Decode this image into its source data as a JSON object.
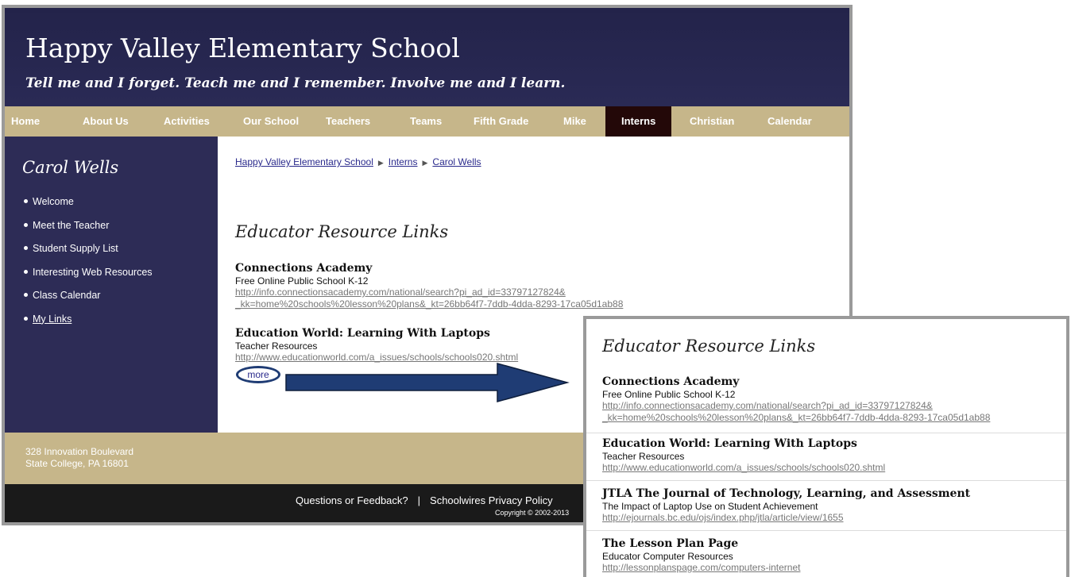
{
  "site": {
    "title": "Happy Valley Elementary School",
    "tagline": "Tell me and I forget. Teach me and I remember. Involve me and I learn."
  },
  "nav": [
    "Home",
    "About Us",
    "Activities",
    "Our School",
    "Teachers",
    "Teams",
    "Fifth Grade",
    "Mike",
    "Interns",
    "Christian",
    "Calendar"
  ],
  "nav_active": "Interns",
  "sidebar": {
    "title": "Carol Wells",
    "items": [
      "Welcome",
      "Meet the Teacher",
      "Student Supply List",
      "Interesting Web Resources",
      "Class Calendar",
      "My Links"
    ]
  },
  "breadcrumb": [
    "Happy Valley Elementary School",
    "Interns",
    "Carol Wells"
  ],
  "page_heading": "Educator Resource Links",
  "resources": [
    {
      "title": "Connections Academy",
      "desc": "Free Online Public School K-12",
      "url_line1": "http://info.connectionsacademy.com/national/search?pi_ad_id=33797127824&",
      "url_line2": "_kk=home%20schools%20lesson%20plans&_kt=26bb64f7-7ddb-4dda-8293-17ca05d1ab88"
    },
    {
      "title": "Education World: Learning With Laptops",
      "desc": "Teacher Resources",
      "url_line1": "http://www.educationworld.com/a_issues/schools/schools020.shtml"
    },
    {
      "title": "JTLA The Journal of Technology, Learning, and Assessment",
      "desc": "The Impact of Laptop Use on Student Achievement",
      "url_line1": "http://ejournals.bc.edu/ojs/index.php/jtla/article/view/1655"
    },
    {
      "title": "The Lesson Plan Page",
      "desc": "Educator Computer Resources",
      "url_line1": "http://lessonplanspage.com/computers-internet"
    }
  ],
  "more_label": "more",
  "footer": {
    "address_line1": "328 Innovation Boulevard",
    "address_line2": "State College, PA 16801",
    "feedback_link": "Questions or Feedback?",
    "separator": "|",
    "privacy_link": "Schoolwires Privacy Policy",
    "copyright": "Copyright © 2002-2013"
  },
  "colors": {
    "header_bg": "#23234a",
    "nav_bg": "#c6b68a",
    "nav_active_bg": "#230808",
    "sidebar_bg": "#2d2c56",
    "arrow_fill": "#1f3c74",
    "footer_bg": "#1a1a1a"
  },
  "icons": [
    "breadcrumb-arrow-icon",
    "bullet-icon",
    "callout-arrow-icon"
  ]
}
